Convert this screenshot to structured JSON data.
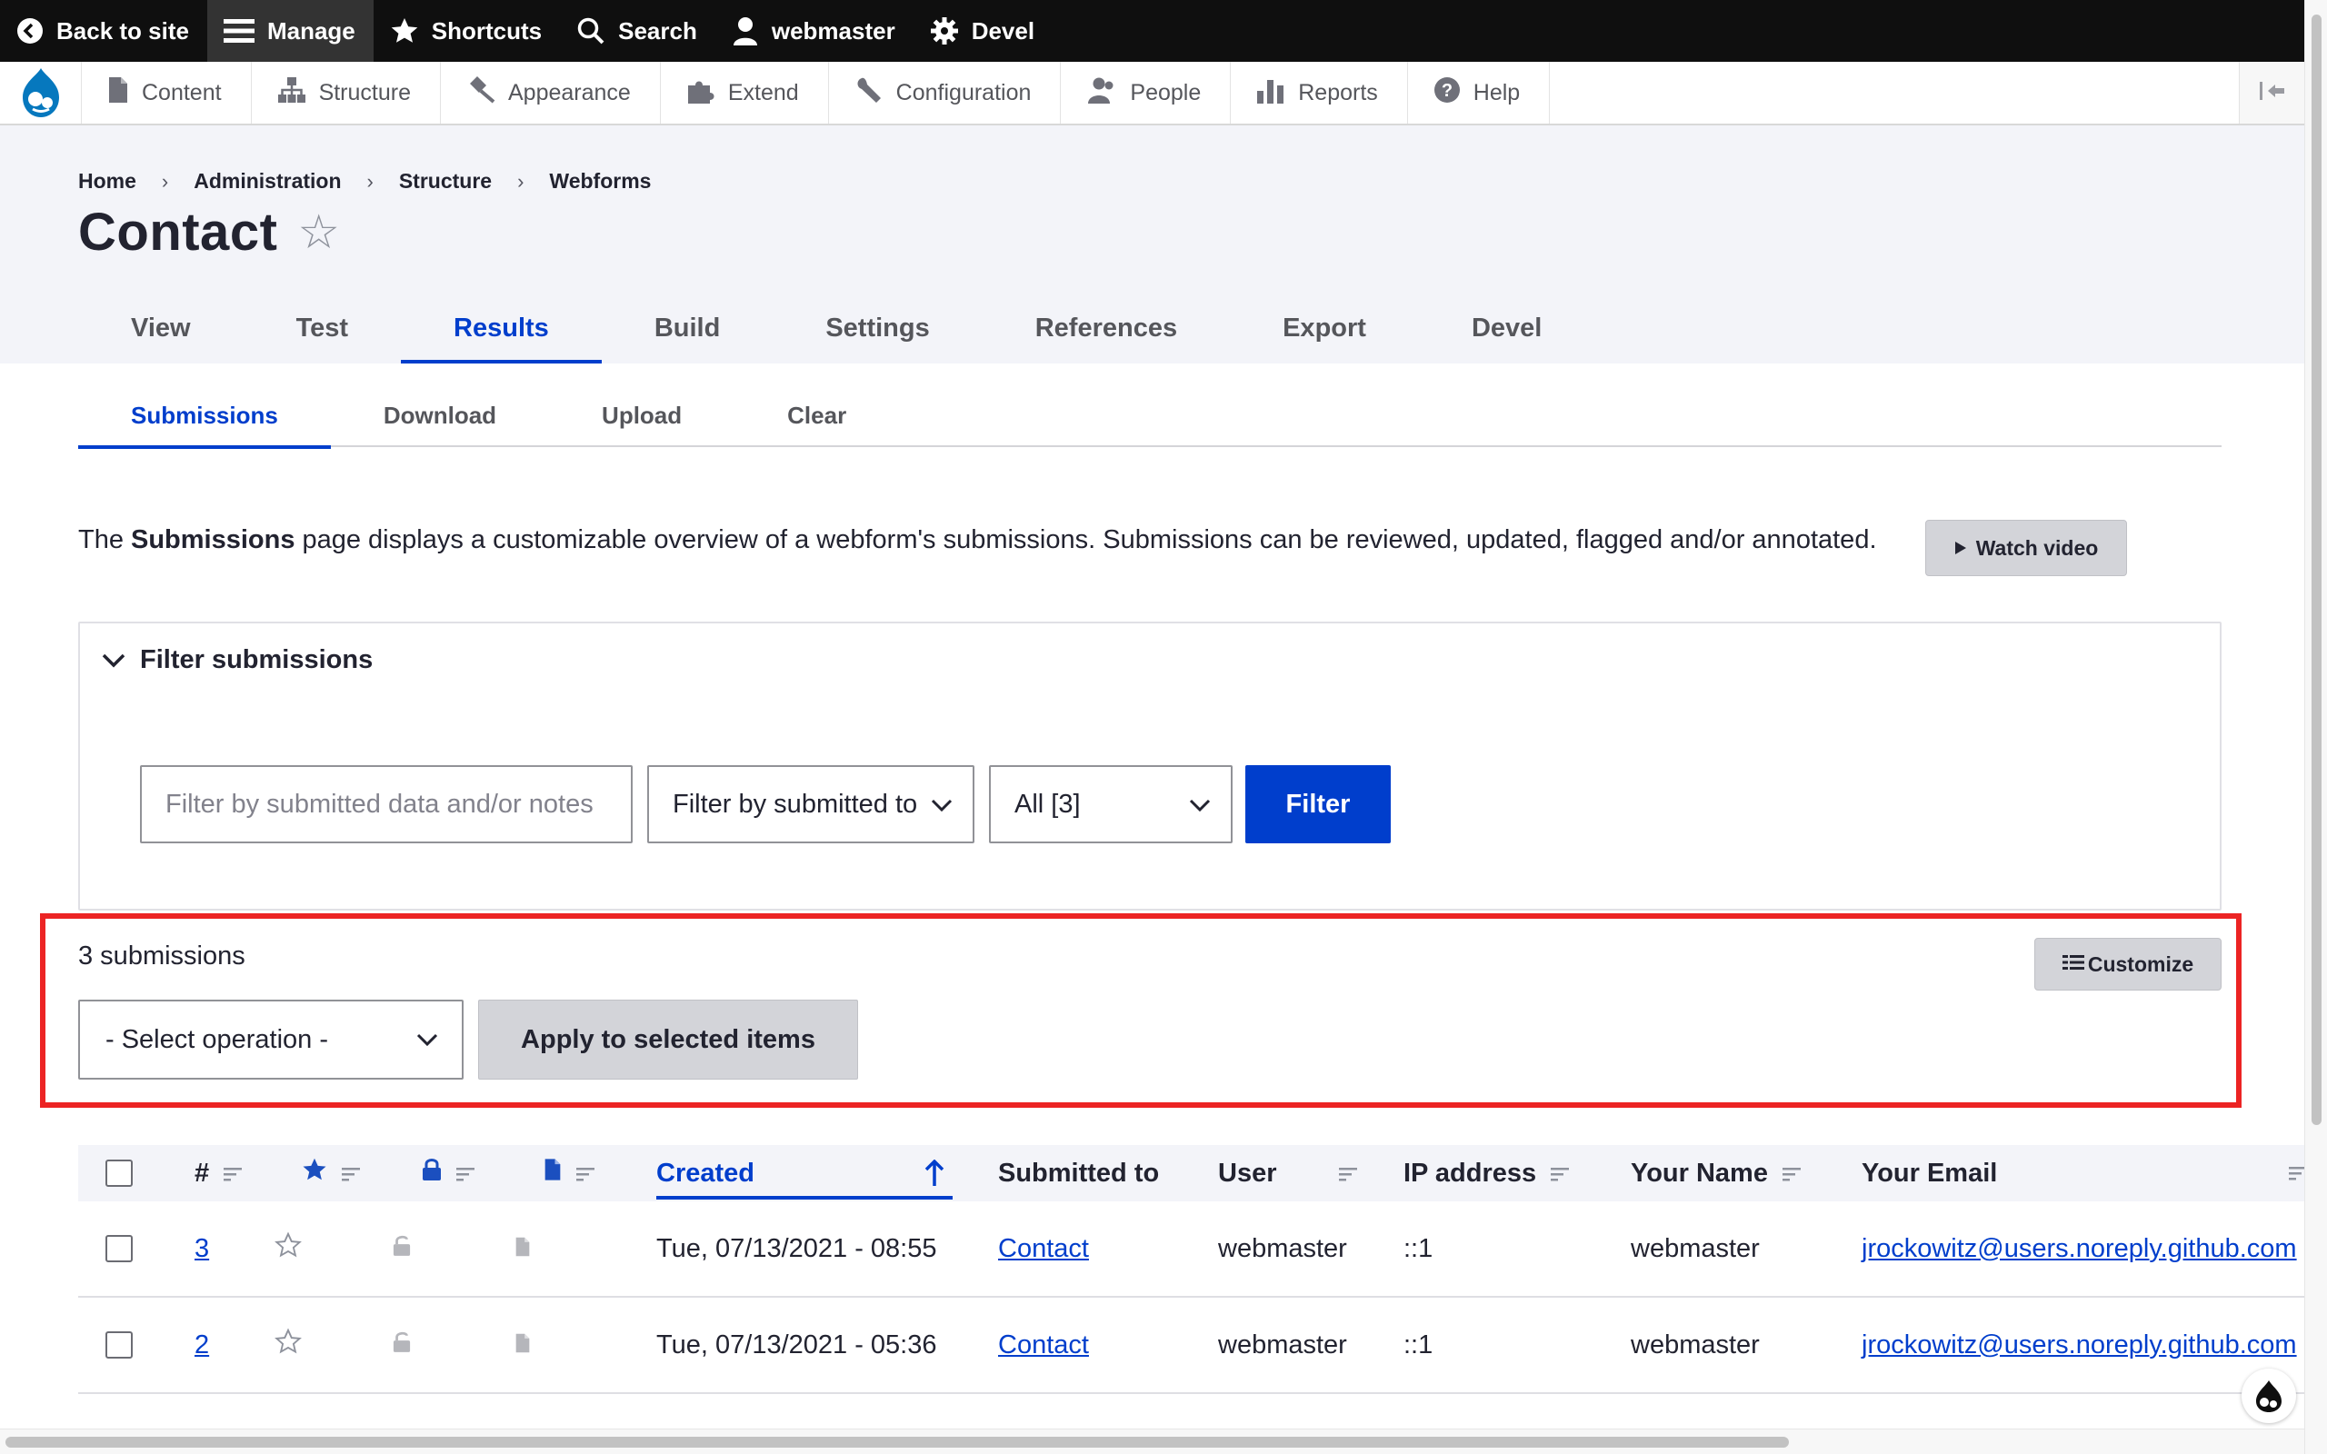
{
  "toolbar": {
    "back_to_site": "Back to site",
    "manage": "Manage",
    "shortcuts": "Shortcuts",
    "search": "Search",
    "user": "webmaster",
    "devel": "Devel"
  },
  "tray": {
    "items": [
      {
        "label": "Content",
        "icon": "file-icon"
      },
      {
        "label": "Structure",
        "icon": "structure-icon"
      },
      {
        "label": "Appearance",
        "icon": "paintbrush-icon"
      },
      {
        "label": "Extend",
        "icon": "puzzle-icon"
      },
      {
        "label": "Configuration",
        "icon": "wrench-icon"
      },
      {
        "label": "People",
        "icon": "people-icon"
      },
      {
        "label": "Reports",
        "icon": "bar-chart-icon"
      },
      {
        "label": "Help",
        "icon": "help-icon"
      }
    ]
  },
  "breadcrumb": [
    "Home",
    "Administration",
    "Structure",
    "Webforms"
  ],
  "page": {
    "title": "Contact",
    "favorite_glyph": "☆"
  },
  "primary_tabs": [
    {
      "label": "View"
    },
    {
      "label": "Test"
    },
    {
      "label": "Results",
      "active": true
    },
    {
      "label": "Build"
    },
    {
      "label": "Settings"
    },
    {
      "label": "References"
    },
    {
      "label": "Export"
    },
    {
      "label": "Devel"
    }
  ],
  "secondary_tabs": [
    {
      "label": "Submissions",
      "active": true
    },
    {
      "label": "Download"
    },
    {
      "label": "Upload"
    },
    {
      "label": "Clear"
    }
  ],
  "description": {
    "before": "The",
    "bold": "Submissions",
    "after": "page displays a customizable overview of a webform's submissions. Submissions can be reviewed, updated, flagged and/or annotated.",
    "watch_video": "Watch video"
  },
  "filter": {
    "legend": "Filter submissions",
    "keyword_placeholder": "Filter by submitted data and/or notes",
    "source_select": "Filter by submitted to",
    "state_select": "All [3]",
    "submit": "Filter"
  },
  "bulk": {
    "count": "3 submissions",
    "customize": "Customize",
    "operation_select": "- Select operation -",
    "apply": "Apply to selected items"
  },
  "table": {
    "headers": {
      "number": "#",
      "created": "Created",
      "submitted_to": "Submitted to",
      "user": "User",
      "ip": "IP address",
      "name": "Your Name",
      "email": "Your Email"
    },
    "rows": [
      {
        "sid": "3",
        "created": "Tue, 07/13/2021 - 08:55",
        "submitted_to": "Contact",
        "user": "webmaster",
        "ip": "::1",
        "name": "webmaster",
        "email": "jrockowitz@users.noreply.github.com"
      },
      {
        "sid": "2",
        "created": "Tue, 07/13/2021 - 05:36",
        "submitted_to": "Contact",
        "user": "webmaster",
        "ip": "::1",
        "name": "webmaster",
        "email": "jrockowitz@users.noreply.github.com"
      }
    ]
  },
  "colors": {
    "accent": "#003ecc",
    "toolbar_bg": "#0f0f0f",
    "highlight": "#ec2424"
  }
}
